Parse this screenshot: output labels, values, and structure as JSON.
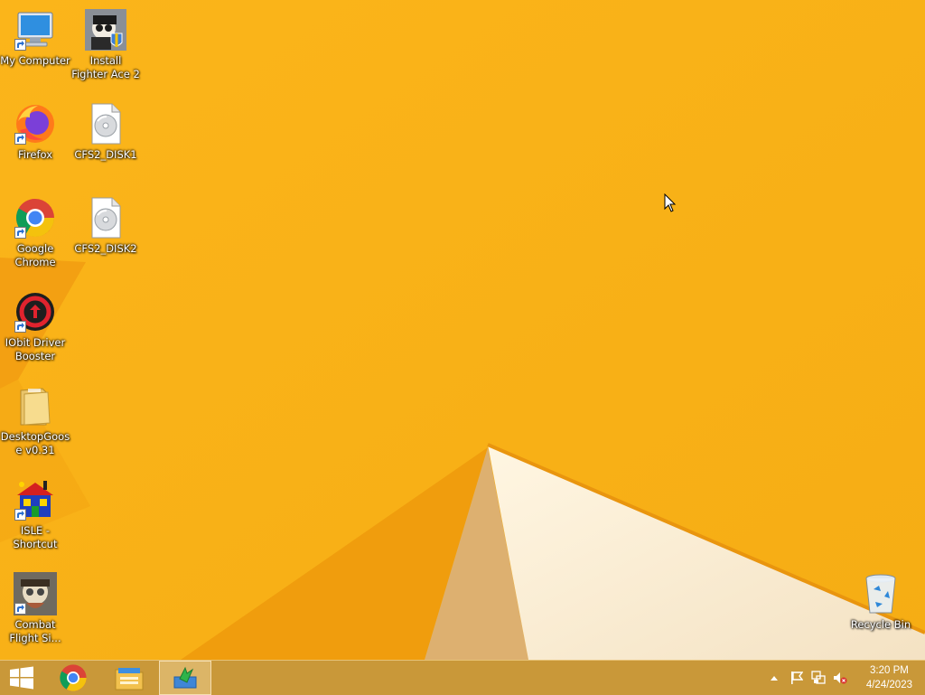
{
  "desktop": {
    "icons": [
      {
        "label": "My Computer",
        "icon": "computer-icon"
      },
      {
        "label": "Install Fighter Ace 2",
        "icon": "installer-icon"
      },
      {
        "label": "Firefox",
        "icon": "firefox-icon"
      },
      {
        "label": "CFS2_DISK1",
        "icon": "disc-image-icon"
      },
      {
        "label": "Google Chrome",
        "icon": "chrome-icon"
      },
      {
        "label": "CFS2_DISK2",
        "icon": "disc-image-icon"
      },
      {
        "label": "IObit Driver Booster",
        "icon": "driver-booster-icon"
      },
      {
        "label": "DesktopGoose v0.31",
        "icon": "folder-icon"
      },
      {
        "label": "ISLE - Shortcut",
        "icon": "lego-island-icon"
      },
      {
        "label": "Combat Flight Si...",
        "icon": "combat-flight-icon"
      },
      {
        "label": "Recycle Bin",
        "icon": "recycle-bin-icon"
      }
    ]
  },
  "taskbar": {
    "start": "windows-logo-icon",
    "pinned": [
      "chrome-icon",
      "file-explorer-icon",
      "installer-app-icon"
    ],
    "tray": [
      "show-hidden-icons-icon",
      "action-center-flag-icon",
      "network-icon",
      "volume-muted-icon"
    ],
    "clock": {
      "time": "3:20 PM",
      "date": "4/24/2023"
    }
  },
  "colors": {
    "wallpaper": "#f7b21a",
    "taskbar": "#c4963c"
  }
}
